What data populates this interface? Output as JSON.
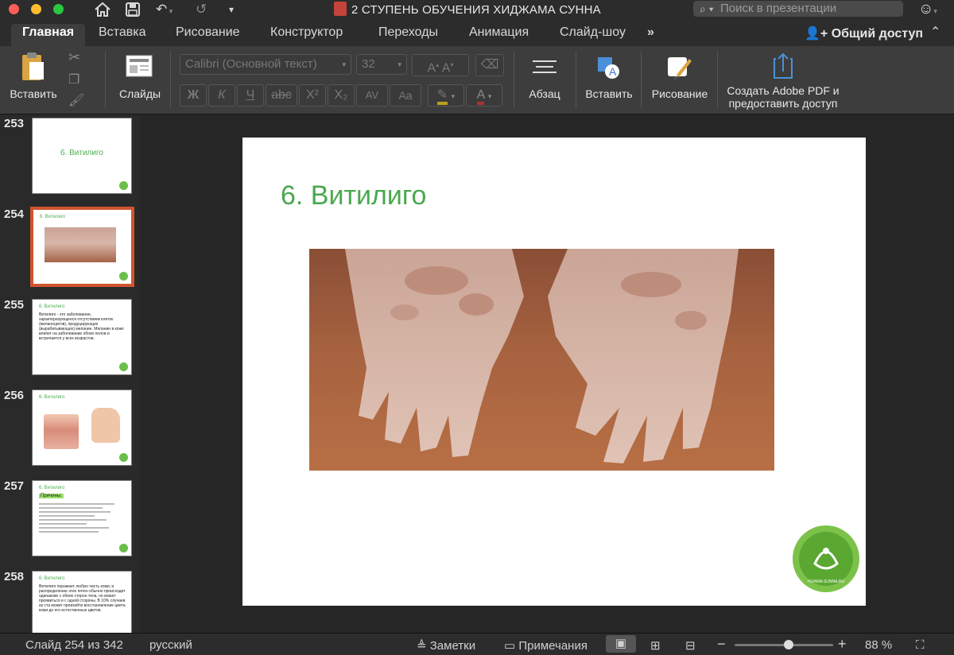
{
  "window": {
    "title": "2 СТУПЕНЬ ОБУЧЕНИЯ ХИДЖАМА СУННА",
    "search_placeholder": "Поиск в презентации"
  },
  "tabs": [
    {
      "label": "Главная",
      "active": true
    },
    {
      "label": "Вставка"
    },
    {
      "label": "Рисование"
    },
    {
      "label": "Конструктор"
    },
    {
      "label": "Переходы"
    },
    {
      "label": "Анимация"
    },
    {
      "label": "Слайд-шоу"
    }
  ],
  "share_label": "Общий доступ",
  "ribbon": {
    "paste_label": "Вставить",
    "slides_label": "Слайды",
    "font_name": "Calibri (Основной текст)",
    "font_size": "32",
    "paragraph_label": "Абзац",
    "insert_label": "Вставить",
    "drawing_label": "Рисование",
    "pdf_label_line1": "Создать Adobe PDF и",
    "pdf_label_line2": "предоставить доступ",
    "format_buttons": [
      "Ж",
      "К",
      "Ч",
      "abc",
      "X²",
      "X₂",
      "AV",
      "Aa"
    ]
  },
  "thumbnails": [
    {
      "number": "253",
      "title": "6. Витилиго",
      "layout": "title"
    },
    {
      "number": "254",
      "title": "6. Витилиго",
      "layout": "image",
      "selected": true
    },
    {
      "number": "255",
      "title": "6. Витилиго",
      "layout": "text",
      "text": "Витилиго - это заболевание, характеризующееся отсутствием клеток (меланоцитов), продуцирующих (вырабатывающих) меланин. Меланин в коже влияет на заболевание обоих полов и встречается у всех возрастов."
    },
    {
      "number": "256",
      "title": "6. Витилиго",
      "layout": "diagram"
    },
    {
      "number": "257",
      "title": "6. Витилиго",
      "layout": "list",
      "badge": "Причины:"
    },
    {
      "number": "258",
      "title": "6. Витилиго",
      "layout": "text",
      "text": "Витилиго поражает любую часть кожи, и распределение этих пятен обычно происходит одинаково с обеих сторон тела, но может проявиться и с одной стороны. В 10% случаев из ста может произойти восстановление цвета кожи до его естественных цветов."
    }
  ],
  "slide": {
    "title": "6. Витилиго",
    "logo_text": "HIJAMA-SUNNA.RU"
  },
  "status": {
    "slide_counter": "Слайд 254 из 342",
    "language": "русский",
    "notes_label": "Заметки",
    "comments_label": "Примечания",
    "zoom": "88 %",
    "zoom_level": 0.55
  },
  "colors": {
    "accent": "#4aa84e",
    "selection": "#d0542e"
  }
}
